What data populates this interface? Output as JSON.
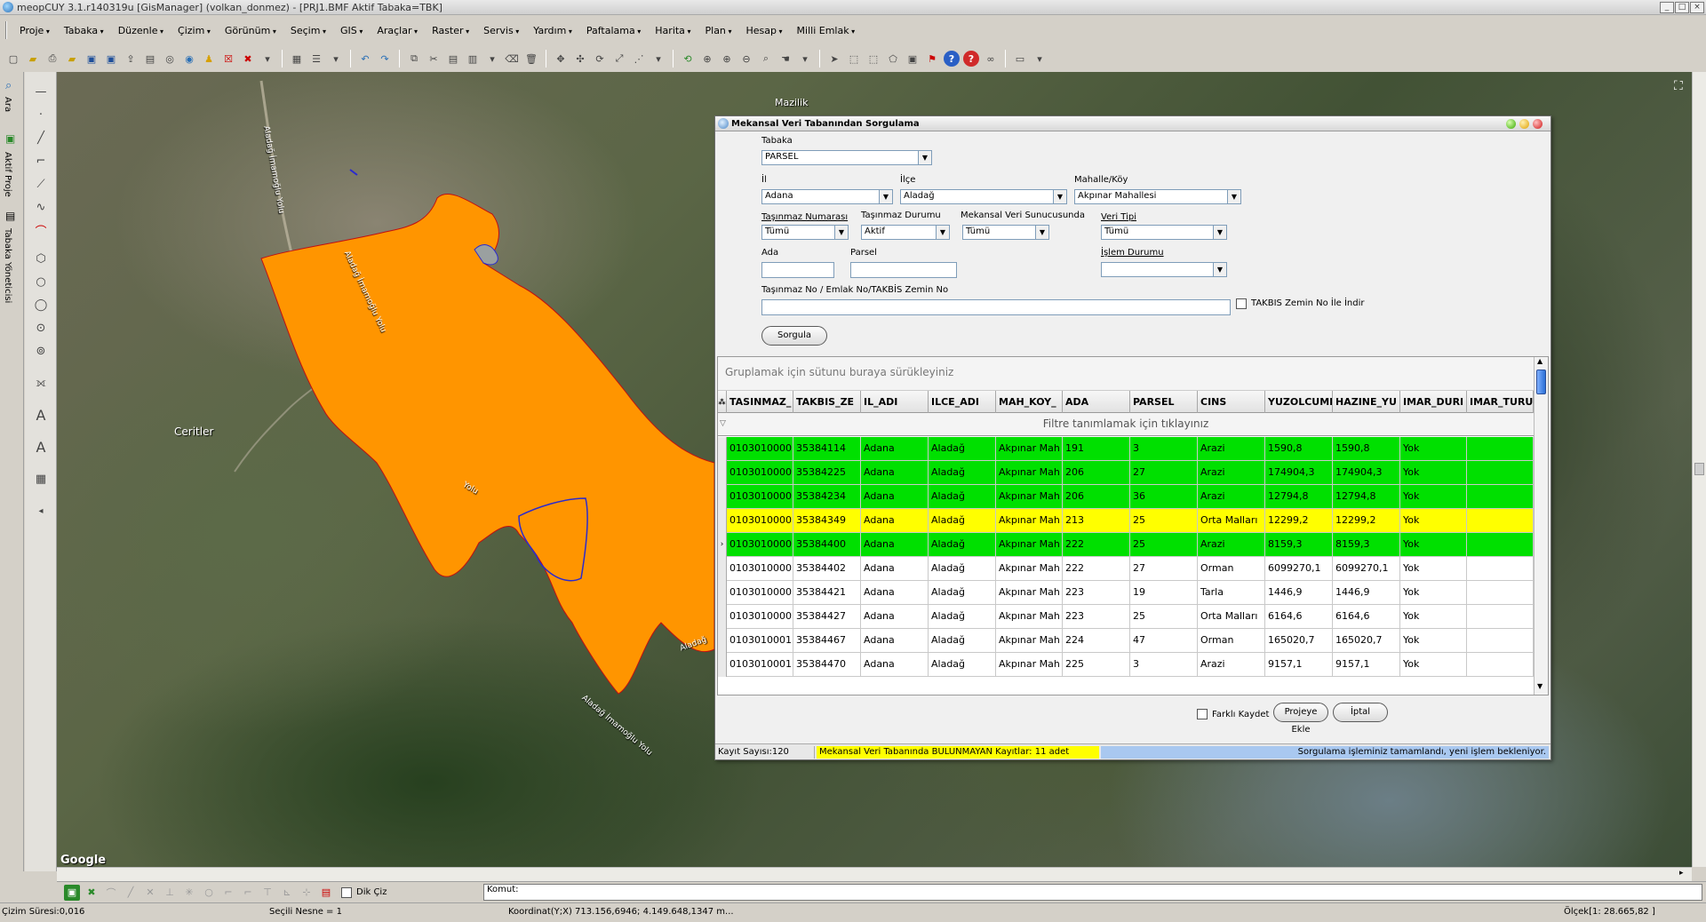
{
  "window": {
    "title": "meopCUY 3.1.r140319u [GisManager] (volkan_donmez) - [PRJ1.BMF  Aktif Tabaka=TBK]",
    "controls": [
      "_",
      "□",
      "×"
    ]
  },
  "menu": [
    "Proje",
    "Tabaka",
    "Düzenle",
    "Çizim",
    "Görünüm",
    "Seçim",
    "GIS",
    "Araçlar",
    "Raster",
    "Servis",
    "Yardım",
    "Paftalama",
    "Harita",
    "Plan",
    "Hesap",
    "Milli Emlak"
  ],
  "left_tabs": [
    "Ara",
    "Aktif Proje",
    "Tabaka Yöneticisi"
  ],
  "map": {
    "labels": [
      "Mazilik",
      "Ceritler",
      "Google"
    ],
    "roads": [
      "Aladağ İmamoğlu Yolu",
      "Aladağ İmamoğlu Yolu",
      "Aladağ İmamoğlu Yolu",
      "Yolu",
      "Aladağ"
    ],
    "parcel_color": "#ff9500"
  },
  "dialog": {
    "title": "Mekansal Veri Tabanından Sorgulama",
    "tabaka_label": "Tabaka",
    "tabaka_value": "PARSEL",
    "il_label": "İl",
    "il_value": "Adana",
    "ilce_label": "İlçe",
    "ilce_value": "Aladağ",
    "mahalle_label": "Mahalle/Köy",
    "mahalle_value": "Akpınar Mahallesi",
    "tasinmaz_no_label": "Taşınmaz Numarası",
    "tasinmaz_no_value": "Tümü",
    "tasinmaz_durum_label": "Taşınmaz Durumu",
    "tasinmaz_durum_value": "Aktif",
    "sunucu_label": "Mekansal Veri Sunucusunda",
    "sunucu_value": "Tümü",
    "veri_tipi_label": "Veri Tipi",
    "veri_tipi_value": "Tümü",
    "ada_label": "Ada",
    "parsel_label": "Parsel",
    "islem_label": "İşlem Durumu",
    "tasinmaz_emlak_label": "Taşınmaz No / Emlak No/TAKBİS Zemin No",
    "takbis_check_label": "TAKBIS Zemin No İle İndir",
    "sorgula_label": "Sorgula",
    "group_hint": "Gruplamak için sütunu buraya sürükleyiniz",
    "filter_hint": "Filtre tanımlamak için tıklayınız",
    "columns": [
      "TASINMAZ_",
      "TAKBIS_ZE",
      "IL_ADI",
      "ILCE_ADI",
      "MAH_KOY_",
      "ADA",
      "PARSEL",
      "CINS",
      "YUZOLCUMI",
      "HAZINE_YU",
      "IMAR_DURI",
      "IMAR_TURU"
    ],
    "rows": [
      {
        "c": [
          "0103010000",
          "35384114",
          "Adana",
          "Aladağ",
          "Akpınar Mah",
          "191",
          "3",
          "Arazi",
          "1590,8",
          "1590,8",
          "Yok",
          ""
        ],
        "color": "#00e000"
      },
      {
        "c": [
          "0103010000",
          "35384225",
          "Adana",
          "Aladağ",
          "Akpınar Mah",
          "206",
          "27",
          "Arazi",
          "174904,3",
          "174904,3",
          "Yok",
          ""
        ],
        "color": "#00e000"
      },
      {
        "c": [
          "0103010000",
          "35384234",
          "Adana",
          "Aladağ",
          "Akpınar Mah",
          "206",
          "36",
          "Arazi",
          "12794,8",
          "12794,8",
          "Yok",
          ""
        ],
        "color": "#00e000"
      },
      {
        "c": [
          "0103010000",
          "35384349",
          "Adana",
          "Aladağ",
          "Akpınar Mah",
          "213",
          "25",
          "Orta Malları",
          "12299,2",
          "12299,2",
          "Yok",
          ""
        ],
        "color": "#ffff00"
      },
      {
        "c": [
          "0103010000",
          "35384400",
          "Adana",
          "Aladağ",
          "Akpınar Mah",
          "222",
          "25",
          "Arazi",
          "8159,3",
          "8159,3",
          "Yok",
          ""
        ],
        "color": "#00e000"
      },
      {
        "c": [
          "0103010000",
          "35384402",
          "Adana",
          "Aladağ",
          "Akpınar Mah",
          "222",
          "27",
          "Orman",
          "6099270,1",
          "6099270,1",
          "Yok",
          ""
        ],
        "color": "#ffffff"
      },
      {
        "c": [
          "0103010000",
          "35384421",
          "Adana",
          "Aladağ",
          "Akpınar Mah",
          "223",
          "19",
          "Tarla",
          "1446,9",
          "1446,9",
          "Yok",
          ""
        ],
        "color": "#ffffff"
      },
      {
        "c": [
          "0103010000",
          "35384427",
          "Adana",
          "Aladağ",
          "Akpınar Mah",
          "223",
          "25",
          "Orta Malları",
          "6164,6",
          "6164,6",
          "Yok",
          ""
        ],
        "color": "#ffffff"
      },
      {
        "c": [
          "0103010001",
          "35384467",
          "Adana",
          "Aladağ",
          "Akpınar Mah",
          "224",
          "47",
          "Orman",
          "165020,7",
          "165020,7",
          "Yok",
          ""
        ],
        "color": "#ffffff"
      },
      {
        "c": [
          "0103010001",
          "35384470",
          "Adana",
          "Aladağ",
          "Akpınar Mah",
          "225",
          "3",
          "Arazi",
          "9157,1",
          "9157,1",
          "Yok",
          ""
        ],
        "color": "#ffffff"
      }
    ],
    "farkli_kaydet_label": "Farklı Kaydet",
    "projeye_ekle_label": "Projeye Ekle",
    "iptal_label": "İptal",
    "status_count": "Kayıt Sayısı:120",
    "status_missing": "Mekansal Veri Tabanında BULUNMAYAN Kayıtlar: 11 adet",
    "status_message": "Sorgulama işleminiz tamamlandı, yeni işlem bekleniyor."
  },
  "command": {
    "dik_ciz_label": "Dik Çiz",
    "komut_label": "Komut:"
  },
  "status": {
    "cizim_suresi": "Çizim Süresi:0,016",
    "secili_nesne": "Seçili Nesne = 1",
    "koordinat": "Koordinat(Y;X)  713.156,6946; 4.149.648,1347 m...",
    "olcek": "Ölçek[1: 28.665,82 ]"
  }
}
